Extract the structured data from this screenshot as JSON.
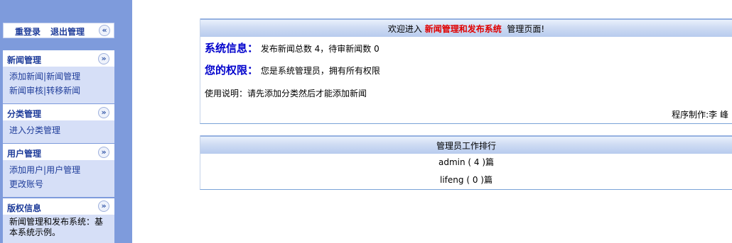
{
  "sidebar": {
    "top_links": {
      "relogin": "重登录",
      "logout": "退出管理"
    },
    "collapse_icon": "double-chevron-left-icon",
    "sections": [
      {
        "title": "新闻管理",
        "icon": "double-chevron-down-icon",
        "lines": [
          [
            "添加新闻",
            "新闻管理"
          ],
          [
            "新闻审核",
            "转移新闻"
          ]
        ]
      },
      {
        "title": "分类管理",
        "icon": "double-chevron-down-icon",
        "lines": [
          [
            "进入分类管理"
          ]
        ]
      },
      {
        "title": "用户管理",
        "icon": "double-chevron-down-icon",
        "lines": [
          [
            "添加用户",
            "用户管理"
          ],
          [
            "更改账号"
          ]
        ]
      }
    ],
    "copyright": {
      "title": "版权信息",
      "icon": "double-chevron-down-icon",
      "text": "新闻管理和发布系统：基本系统示例。"
    }
  },
  "welcome": {
    "prefix": "欢迎进入",
    "system_name": "新闻管理和发布系统",
    "suffix": "管理页面!",
    "system_info_label": "系统信息：",
    "system_info_text": "发布新闻总数 4，待审新闻数 0",
    "permission_label": "您的权限：",
    "permission_text": "您是系统管理员，拥有所有权限",
    "usage_note": "使用说明：请先添加分类然后才能添加新闻",
    "author": "程序制作:李 峰"
  },
  "ranking": {
    "title": "管理员工作排行",
    "rows": [
      "admin ( 4 )篇",
      "lifeng ( 0 )篇"
    ]
  },
  "colors": {
    "sidebar_bg": "#7e9bdc",
    "link": "#1f3d9a",
    "highlight": "#e00000",
    "label_blue": "#0000cc"
  }
}
